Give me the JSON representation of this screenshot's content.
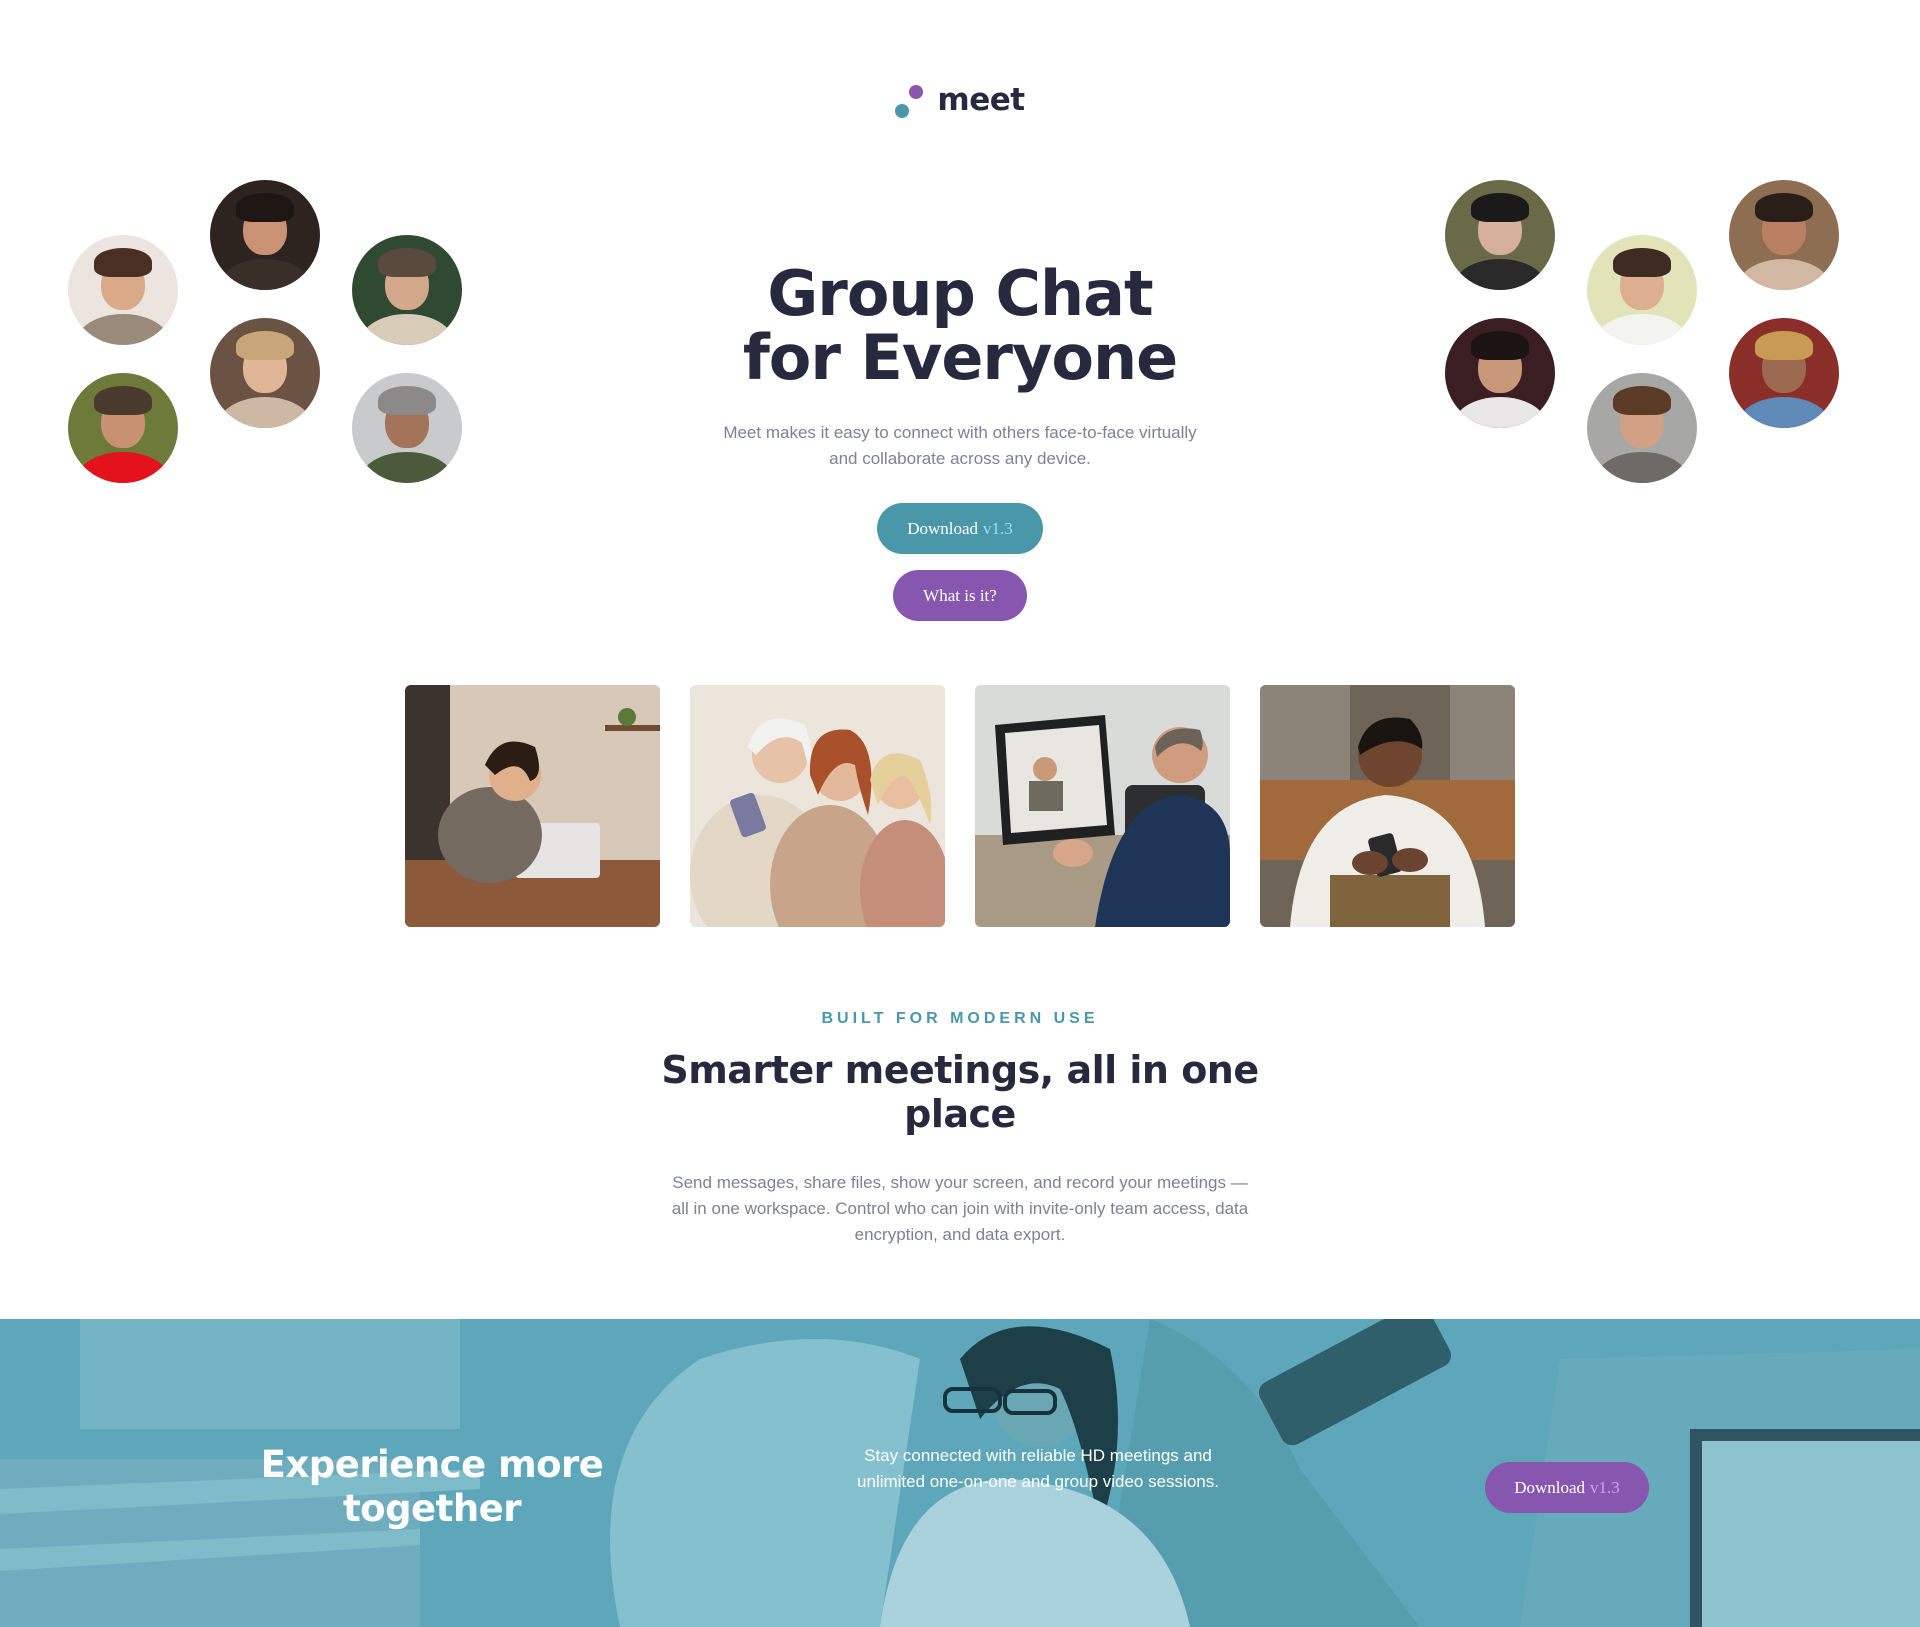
{
  "logo": {
    "text": "meet"
  },
  "hero": {
    "title_line1": "Group Chat",
    "title_line2": "for Everyone",
    "subtitle": "Meet makes it easy to connect with others face-to-face virtually and collaborate across any device.",
    "download_label": "Download",
    "download_version": "v1.3",
    "what_label": "What is it?"
  },
  "features": {
    "eyebrow": "BUILT FOR MODERN USE",
    "title": "Smarter meetings, all in one place",
    "body": "Send messages, share files, show your screen, and record your meetings — all in one workspace. Control who can join with invite-only team access, data encryption, and data export."
  },
  "banner": {
    "title": "Experience more together",
    "text": "Stay connected with reliable HD meetings and unlimited one-on-one and group video sessions.",
    "download_label": "Download",
    "download_version": "v1.3"
  },
  "colors": {
    "teal": "#4b97aa",
    "purple": "#8757b0",
    "dark": "#272a3e",
    "muted": "#7f8095",
    "banner": "#5ea6b9"
  }
}
